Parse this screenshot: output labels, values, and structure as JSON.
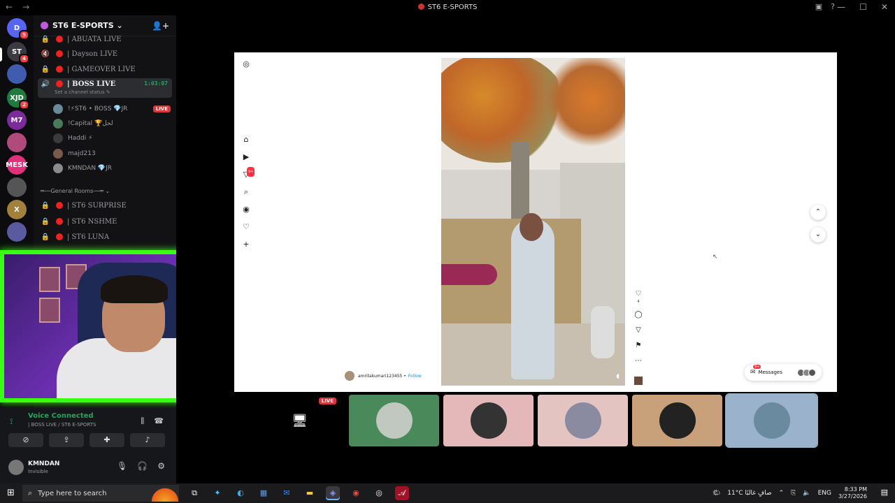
{
  "window": {
    "title": "ST6 E-SPORTS",
    "controls": [
      "—",
      "☐",
      "✕"
    ]
  },
  "servers": [
    {
      "label": "D",
      "badge": "5",
      "color": "#5865f2"
    },
    {
      "label": "ST",
      "badge": "4",
      "color": "#3a3a40"
    },
    {
      "label": "",
      "badge": "",
      "color": "#3f5cae"
    },
    {
      "label": "XJD",
      "badge": "2",
      "color": "#1f7a3e"
    },
    {
      "label": "M7",
      "badge": "",
      "color": "#7a2a9a"
    },
    {
      "label": "",
      "badge": "",
      "color": "#b04a7a"
    },
    {
      "label": "MESK",
      "badge": "",
      "color": "#e0307a"
    },
    {
      "label": "",
      "badge": "",
      "color": "#555"
    },
    {
      "label": "X",
      "badge": "",
      "color": "#a0803a"
    },
    {
      "label": "",
      "badge": "",
      "color": "#5a5aa0"
    }
  ],
  "guild": {
    "name": "ST6 E-SPORTS ⌄"
  },
  "channels": [
    {
      "icon": "🔒",
      "name": "| ABUATA LIVE"
    },
    {
      "icon": "🔇",
      "name": "| Dayson LIVE"
    },
    {
      "icon": "🔒",
      "name": "| GAMEOVER LIVE"
    }
  ],
  "active_channel": {
    "name": "| BOSS LIVE",
    "timer": "1:03:07",
    "status": "Set a channel status ✎"
  },
  "members": [
    {
      "name": "!⚡ST6 • BOSS 💎JR",
      "live": "LIVE",
      "color": "#6a8a9a"
    },
    {
      "name": "!Capital 🏆لحل",
      "live": "",
      "color": "#4a7a5a"
    },
    {
      "name": "Haddi ⚡",
      "live": "",
      "color": "#3a3a3a"
    },
    {
      "name": "majd213",
      "live": "",
      "color": "#7a5a4a"
    },
    {
      "name": "KMNDAN 💎JR",
      "live": "",
      "color": "#8a8a8a"
    }
  ],
  "category": "═──General Rooms──═ ⌄",
  "rooms": [
    {
      "name": "| ST6 SURPRISE"
    },
    {
      "name": "| ST6 NSHME"
    },
    {
      "name": "| ST6 LUNA"
    }
  ],
  "voice": {
    "status": "Voice Connected",
    "channel": "| BOSS LIVE / ST6 E-SPORTS"
  },
  "user": {
    "name": "KMNDAN",
    "status": "Invisible"
  },
  "stream": {
    "author": "amritakumari123455",
    "follow": "Follow",
    "likes": "4",
    "messages_label": "Messages",
    "messages_badge": "9+",
    "notif_badge": "9+"
  },
  "tiles": [
    {
      "type": "screen",
      "live": "LIVE",
      "bg": "#000"
    },
    {
      "type": "avatar",
      "bg": "#4a8a5a",
      "av": "#c0c8c0"
    },
    {
      "type": "avatar",
      "bg": "#e4b8b8",
      "av": "#333"
    },
    {
      "type": "avatar",
      "bg": "#e4c4c0",
      "av": "#8a8aa0"
    },
    {
      "type": "avatar",
      "bg": "#c8a07a",
      "av": "#222"
    },
    {
      "type": "avatar",
      "bg": "#9ab2cc",
      "av": "#6a8aa0",
      "selected": true
    }
  ],
  "taskbar": {
    "search_placeholder": "Type here to search",
    "weather": "11°C  صافٍ غالبًا",
    "lang": "ENG",
    "time": "8:33 PM",
    "date": "3/27/2026",
    "notif_count": "4"
  }
}
